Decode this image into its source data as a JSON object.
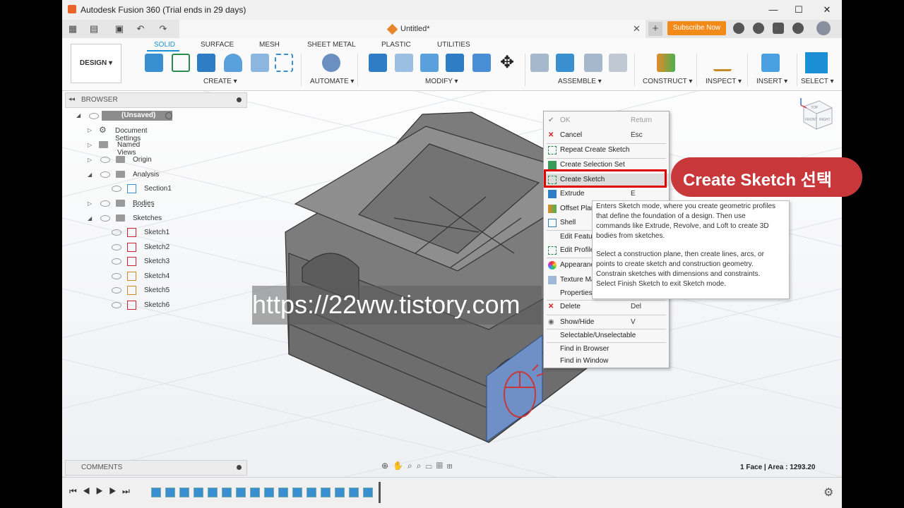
{
  "window": {
    "title": "Autodesk Fusion 360 (Trial ends in 29 days)",
    "controls": [
      "—",
      "☐",
      "✕"
    ]
  },
  "header": {
    "doc_title": "Untitled*",
    "subscribe": "Subscribe Now",
    "close": "✕",
    "plus": "+"
  },
  "toolbar": {
    "workspace": "DESIGN ▾",
    "tabs": [
      "SOLID",
      "SURFACE",
      "MESH",
      "SHEET METAL",
      "PLASTIC",
      "UTILITIES"
    ],
    "groups": [
      "CREATE ▾",
      "AUTOMATE ▾",
      "MODIFY ▾",
      "ASSEMBLE ▾",
      "CONSTRUCT ▾",
      "INSPECT ▾",
      "INSERT ▾",
      "SELECT ▾"
    ]
  },
  "browser": {
    "title": "BROWSER",
    "items": [
      {
        "label": "(Unsaved)"
      },
      {
        "label": "Document Settings"
      },
      {
        "label": "Named Views"
      },
      {
        "label": "Origin"
      },
      {
        "label": "Analysis"
      },
      {
        "label": "Section1"
      },
      {
        "label": "Bodies"
      },
      {
        "label": "Sketches"
      },
      {
        "label": "Sketch1"
      },
      {
        "label": "Sketch2"
      },
      {
        "label": "Sketch3"
      },
      {
        "label": "Sketch4"
      },
      {
        "label": "Sketch5"
      },
      {
        "label": "Sketch6"
      }
    ]
  },
  "comments": {
    "title": "COMMENTS"
  },
  "status": {
    "text": "1 Face | Area : 1293.20"
  },
  "context_menu": {
    "items": [
      {
        "label": "OK",
        "shortcut": "Return"
      },
      {
        "label": "Cancel",
        "shortcut": "Esc"
      },
      {
        "label": "Repeat Create Sketch",
        "shortcut": ""
      },
      {
        "label": "Create Selection Set",
        "shortcut": ""
      },
      {
        "label": "Create Sketch",
        "shortcut": ""
      },
      {
        "label": "Extrude",
        "shortcut": "E"
      },
      {
        "label": "Offset Plan",
        "shortcut": ""
      },
      {
        "label": "Shell",
        "shortcut": ""
      },
      {
        "label": "Edit Featur",
        "shortcut": ""
      },
      {
        "label": "Edit Profile",
        "shortcut": ""
      },
      {
        "label": "Appearanc",
        "shortcut": ""
      },
      {
        "label": "Texture Ma",
        "shortcut": ""
      },
      {
        "label": "Properties",
        "shortcut": ""
      },
      {
        "label": "Delete",
        "shortcut": "Del"
      },
      {
        "label": "Show/Hide",
        "shortcut": "V"
      },
      {
        "label": "Selectable/Unselectable",
        "shortcut": ""
      },
      {
        "label": "Find in Browser",
        "shortcut": ""
      },
      {
        "label": "Find in Window",
        "shortcut": ""
      }
    ]
  },
  "tooltip": {
    "p1": "Enters Sketch mode, where you create geometric profiles\nthat define the foundation of a design. Then use\ncommands like Extrude, Revolve, and Loft to create 3D\nbodies from sketches.",
    "p2": "Select a construction plane, then create lines, arcs, or\npoints to create sketch and construction geometry.\nConstrain sketches with dimensions and constraints.\nSelect Finish Sketch to exit Sketch mode."
  },
  "annotation": {
    "callout": "Create Sketch 선택",
    "watermark": "https://22ww.tistory.com"
  },
  "viewcube": {
    "labels": [
      "TOP",
      "FRONT",
      "RIGHT"
    ]
  },
  "colors": {
    "accent": "#1a8fd6",
    "callout": "#c8373a",
    "highlight": "#e00000",
    "face": "#6f90c6",
    "body": "#7c7c7c"
  }
}
